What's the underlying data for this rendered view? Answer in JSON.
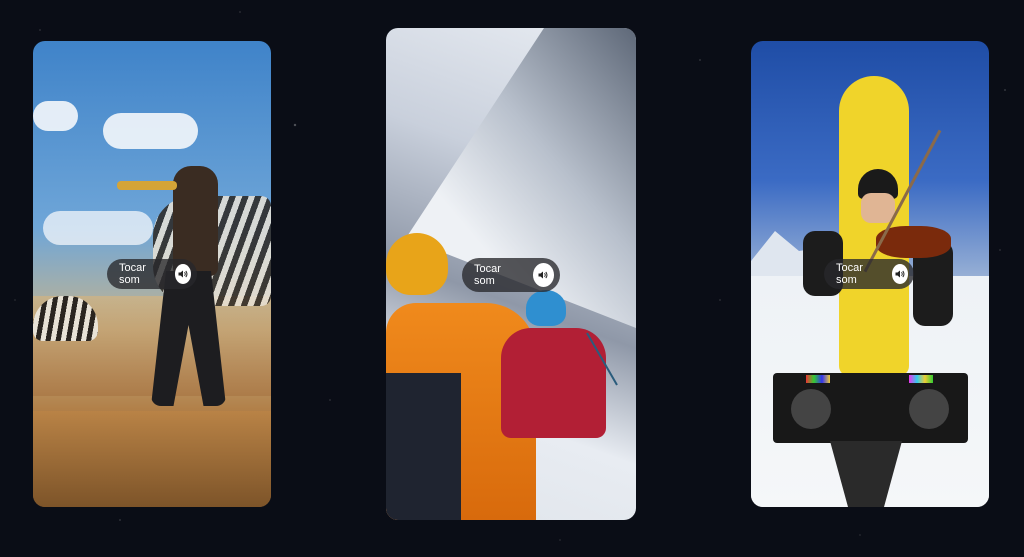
{
  "cards": [
    {
      "sound_label": "Tocar som",
      "sound_icon": "speaker-icon"
    },
    {
      "sound_label": "Tocar som",
      "sound_icon": "speaker-icon"
    },
    {
      "sound_label": "Tocar som",
      "sound_icon": "speaker-icon"
    }
  ]
}
